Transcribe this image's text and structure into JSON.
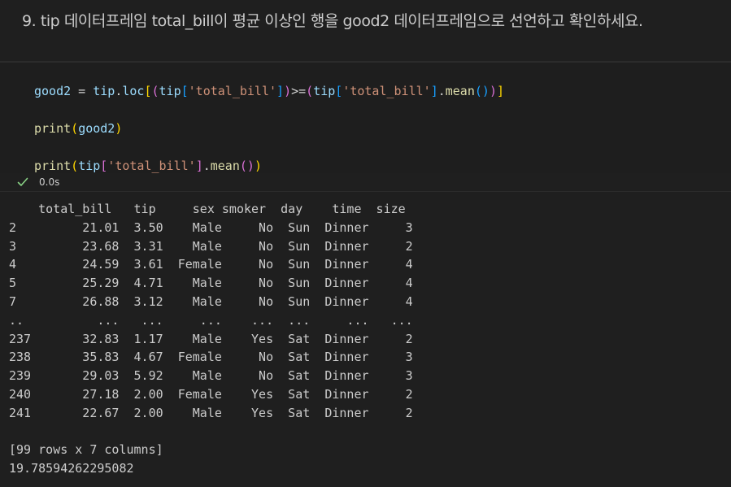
{
  "markdown": {
    "heading": "9. tip 데이터프레임 total_bill이 평균 이상인 행을 good2 데이터프레임으로 선언하고 확인하세요."
  },
  "code_cell": {
    "lines": [
      {
        "tokens": [
          {
            "t": "good2",
            "c": "v"
          },
          {
            "t": " = ",
            "c": "p"
          },
          {
            "t": "tip",
            "c": "v"
          },
          {
            "t": ".",
            "c": "p"
          },
          {
            "t": "loc",
            "c": "v"
          },
          {
            "t": "[",
            "c": "b1"
          },
          {
            "t": "(",
            "c": "b2"
          },
          {
            "t": "tip",
            "c": "v"
          },
          {
            "t": "[",
            "c": "b3"
          },
          {
            "t": "'total_bill'",
            "c": "s"
          },
          {
            "t": "]",
            "c": "b3"
          },
          {
            "t": ")",
            "c": "b2"
          },
          {
            "t": ">=",
            "c": "p"
          },
          {
            "t": "(",
            "c": "b2"
          },
          {
            "t": "tip",
            "c": "v"
          },
          {
            "t": "[",
            "c": "b3"
          },
          {
            "t": "'total_bill'",
            "c": "s"
          },
          {
            "t": "]",
            "c": "b3"
          },
          {
            "t": ".",
            "c": "p"
          },
          {
            "t": "mean",
            "c": "f"
          },
          {
            "t": "(",
            "c": "b3"
          },
          {
            "t": ")",
            "c": "b3"
          },
          {
            "t": ")",
            "c": "b2"
          },
          {
            "t": "]",
            "c": "b1"
          }
        ]
      },
      {
        "tokens": [
          {
            "t": "print",
            "c": "f"
          },
          {
            "t": "(",
            "c": "b1"
          },
          {
            "t": "good2",
            "c": "v"
          },
          {
            "t": ")",
            "c": "b1"
          }
        ]
      },
      {
        "tokens": [
          {
            "t": "print",
            "c": "f"
          },
          {
            "t": "(",
            "c": "b1"
          },
          {
            "t": "tip",
            "c": "v"
          },
          {
            "t": "[",
            "c": "b2"
          },
          {
            "t": "'total_bill'",
            "c": "s"
          },
          {
            "t": "]",
            "c": "b2"
          },
          {
            "t": ".",
            "c": "p"
          },
          {
            "t": "mean",
            "c": "f"
          },
          {
            "t": "(",
            "c": "b2"
          },
          {
            "t": ")",
            "c": "b2"
          },
          {
            "t": ")",
            "c": "b1"
          }
        ]
      }
    ]
  },
  "status": {
    "exec_time": "0.0s",
    "icon": "check-icon",
    "icon_color": "#89d185"
  },
  "output": {
    "lines": [
      "    total_bill   tip     sex smoker  day    time  size",
      "2         21.01  3.50    Male     No  Sun  Dinner     3",
      "3         23.68  3.31    Male     No  Sun  Dinner     2",
      "4         24.59  3.61  Female     No  Sun  Dinner     4",
      "5         25.29  4.71    Male     No  Sun  Dinner     4",
      "7         26.88  3.12    Male     No  Sun  Dinner     4",
      "..          ...   ...     ...    ...  ...     ...   ...",
      "237       32.83  1.17    Male    Yes  Sat  Dinner     2",
      "238       35.83  4.67  Female     No  Sat  Dinner     3",
      "239       29.03  5.92    Male     No  Sat  Dinner     3",
      "240       27.18  2.00  Female    Yes  Sat  Dinner     2",
      "241       22.67  2.00    Male    Yes  Sat  Dinner     2",
      "",
      "[99 rows x 7 columns]",
      "19.78594262295082"
    ]
  }
}
